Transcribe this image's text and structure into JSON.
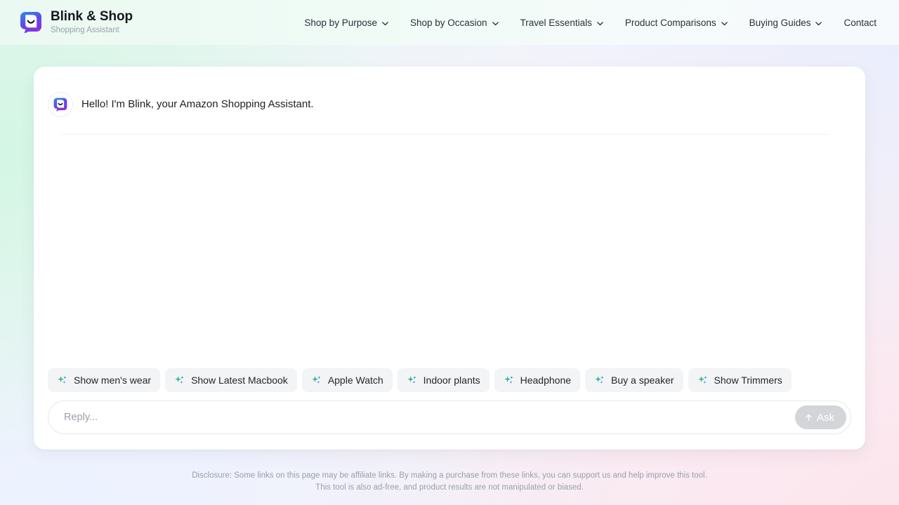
{
  "header": {
    "logo_icon": "blink-chat-bubble-logo",
    "brand_title": "Blink & Shop",
    "brand_subtitle": "Shopping Assistant",
    "nav": [
      {
        "label": "Shop by Purpose",
        "has_dropdown": true
      },
      {
        "label": "Shop by Occasion",
        "has_dropdown": true
      },
      {
        "label": "Travel Essentials",
        "has_dropdown": true
      },
      {
        "label": "Product Comparisons",
        "has_dropdown": true
      },
      {
        "label": "Buying Guides",
        "has_dropdown": true
      },
      {
        "label": "Contact",
        "has_dropdown": false
      }
    ]
  },
  "chat": {
    "messages": [
      {
        "role": "assistant",
        "avatar_icon": "blink-chat-bubble-logo",
        "text": "Hello! I'm Blink, your Amazon Shopping Assistant."
      }
    ],
    "suggestions": [
      {
        "icon": "sparkles-icon",
        "label": "Show men's wear"
      },
      {
        "icon": "sparkles-icon",
        "label": "Show Latest Macbook"
      },
      {
        "icon": "sparkles-icon",
        "label": "Apple Watch"
      },
      {
        "icon": "sparkles-icon",
        "label": "Indoor plants"
      },
      {
        "icon": "sparkles-icon",
        "label": "Headphone"
      },
      {
        "icon": "sparkles-icon",
        "label": "Buy a speaker"
      },
      {
        "icon": "sparkles-icon",
        "label": "Show Trimmers"
      }
    ],
    "composer": {
      "placeholder": "Reply...",
      "value": "",
      "submit_label": "Ask",
      "submit_icon": "arrow-up-icon",
      "submit_disabled": true
    }
  },
  "footer": {
    "disclosure_line1": "Disclosure: Some links on this page may be affiliate links. By making a purchase from these links, you can support us and help improve this tool.",
    "disclosure_line2": "This tool is also ad-free, and product results are not manipulated or biased."
  },
  "colors": {
    "logo_gradient_start": "#2b8cf0",
    "logo_gradient_end": "#8b2fe0",
    "sparkle_teal": "#2bb888",
    "sparkle_blue": "#3b82f6",
    "ask_button_bg": "#d3d5d9",
    "card_bg": "#ffffff",
    "chip_bg": "#f3f4f6"
  }
}
